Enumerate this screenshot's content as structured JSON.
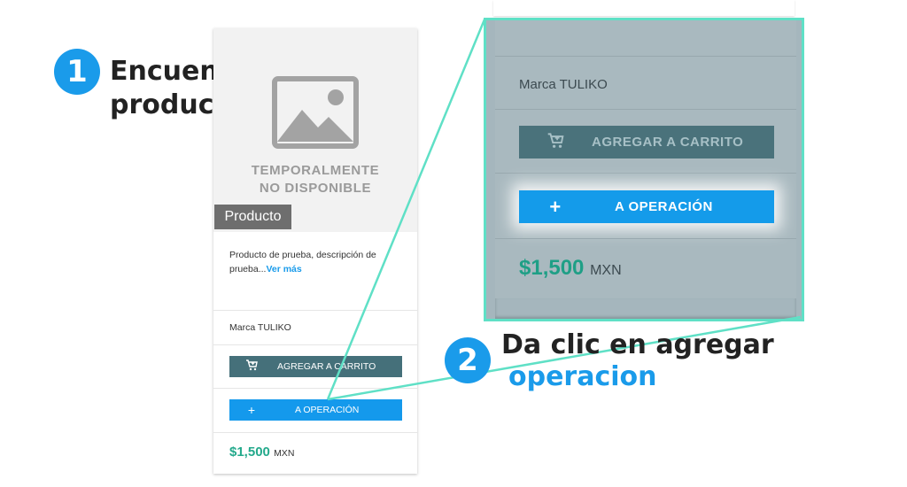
{
  "step1": {
    "number": "1",
    "title_line1": "Encuentra tu",
    "title_line2": "producto"
  },
  "step2": {
    "number": "2",
    "title_line1": "Da clic en agregar",
    "title_line2": "operacion"
  },
  "card": {
    "placeholder_line1": "TEMPORALMENTE",
    "placeholder_line2": "NO DISPONIBLE",
    "tag": "Producto",
    "description": "Producto de prueba, descripción de prueba...",
    "more_link": "Ver más",
    "brand": "Marca TULIKO",
    "cart_button": "AGREGAR A CARRITO",
    "op_button": "A OPERACIÓN",
    "price": "$1,500",
    "currency": "MXN"
  },
  "colors": {
    "accent": "#1a9bea",
    "cart": "#45707a",
    "price": "#23a98b",
    "highlight": "#5fe0c6"
  }
}
